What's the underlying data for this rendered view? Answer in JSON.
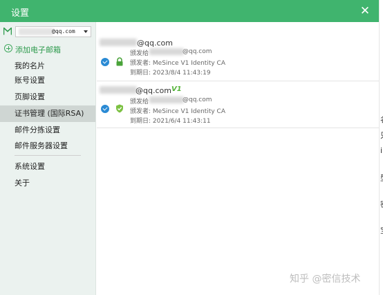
{
  "window": {
    "title": "设置",
    "close_glyph": "✕",
    "accent_color": "#40b46e"
  },
  "account": {
    "selected": "@qq.com"
  },
  "sidebar": {
    "add_label": "添加电子邮箱",
    "items": [
      {
        "label": "我的名片"
      },
      {
        "label": "账号设置"
      },
      {
        "label": "页脚设置"
      },
      {
        "label": "证书管理 (国际RSA)",
        "active": true
      },
      {
        "label": "邮件分拣设置"
      },
      {
        "label": "邮件服务器设置"
      },
      {
        "label": "系统设置"
      },
      {
        "label": "关于"
      }
    ]
  },
  "certificates": [
    {
      "email": "@qq.com",
      "issued_to": "颁发给",
      "issued_to_email": "@qq.com",
      "issuer": "颁发者: MeSince V1 Identity CA",
      "expiry": "到期日: 2023/8/4 11:43:19",
      "status_icon": "lock-icon"
    },
    {
      "email": "@qq.com",
      "badge": "V1",
      "issued_to": "颁发给",
      "issued_to_email": "@qq.com",
      "issuer": "颁发者: MeSince V1 Identity CA",
      "expiry": "到期日: 2021/6/4 11:43:11",
      "status_icon": "shield-check-icon"
    }
  ],
  "background_chars": [
    "名",
    "只",
    "i",
    "型",
    "密",
    "宝"
  ],
  "watermark": "知乎 @密信技术"
}
